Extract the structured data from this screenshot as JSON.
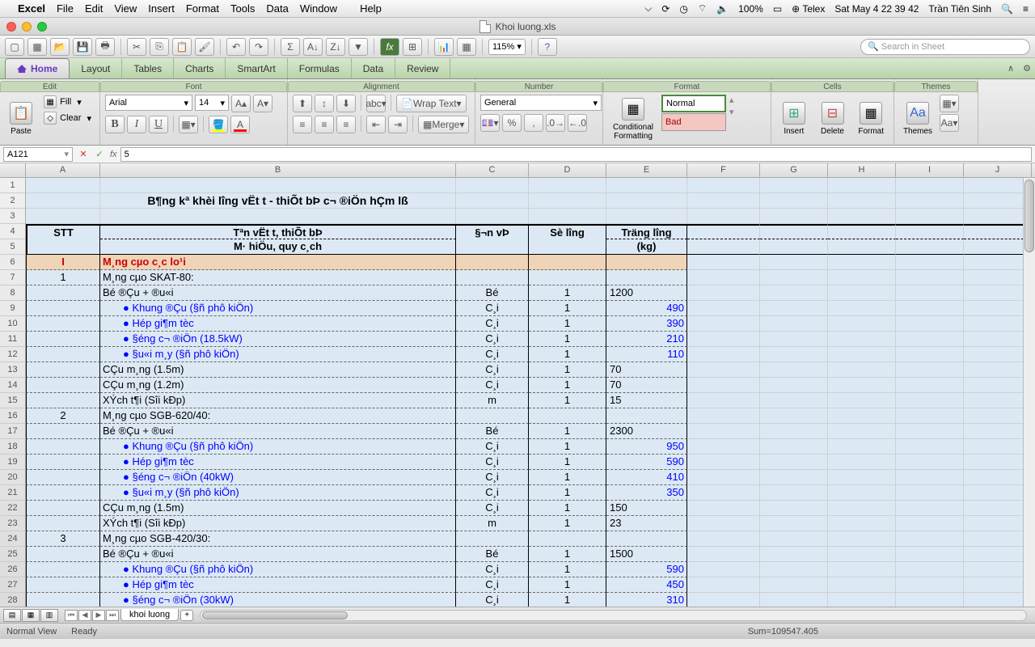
{
  "menubar": {
    "apple": "",
    "items": [
      "Excel",
      "File",
      "Edit",
      "View",
      "Insert",
      "Format",
      "Tools",
      "Data",
      "Window",
      "",
      "Help"
    ],
    "right": {
      "battery": "100%",
      "input": "⊕ Telex",
      "date": "Sat May 4  22 39 42",
      "user": "Trần Tiên Sinh"
    }
  },
  "window": {
    "title": "Khoi luong.xls"
  },
  "toolbar": {
    "zoom": "115%",
    "search_placeholder": "Search in Sheet"
  },
  "tabs": [
    "Home",
    "Layout",
    "Tables",
    "Charts",
    "SmartArt",
    "Formulas",
    "Data",
    "Review"
  ],
  "ribbon": {
    "groups": [
      "Edit",
      "Font",
      "Alignment",
      "Number",
      "Format",
      "Cells",
      "Themes"
    ],
    "edit": {
      "paste": "Paste",
      "fill": "Fill",
      "clear": "Clear"
    },
    "font": {
      "name": "Arial",
      "size": "14"
    },
    "align": {
      "wrap": "Wrap Text",
      "merge": "Merge"
    },
    "number": {
      "format": "General"
    },
    "format": {
      "cf": "Conditional\nFormatting",
      "styles": [
        "Normal",
        "Bad"
      ]
    },
    "cells": {
      "insert": "Insert",
      "delete": "Delete",
      "format": "Format"
    },
    "themes": {
      "themes": "Themes",
      "aa": "Aa"
    }
  },
  "formula": {
    "namebox": "A121",
    "fx": "fx",
    "value": "5"
  },
  "columns": [
    "A",
    "B",
    "C",
    "D",
    "E",
    "F",
    "G",
    "H",
    "I",
    "J"
  ],
  "rows_start": 1,
  "rows_end": 28,
  "sheet": {
    "title": "B¶ng kª khèi l­îng vËt t­ - thiÕt bÞ c¬ ®iÖn hÇm lß",
    "head1": {
      "A": "STT",
      "B": "Tªn vËt t­, thiÕt bÞ",
      "C": "§¬n vÞ",
      "D": "Sè l­îng",
      "E": "Träng l­îng"
    },
    "head2": {
      "B": "M· hiÖu, quy c¸ch",
      "E": "(kg)"
    },
    "section": {
      "A": "I",
      "B": "M¸ng cµo c¸c lo¹i"
    },
    "rows": [
      {
        "A": "1",
        "B": "M¸ng cµo SKAT-80:"
      },
      {
        "B": "Bé ®Çu + ®u«i",
        "C": "Bé",
        "D": "1",
        "E": "1200"
      },
      {
        "Bsub": "Khung ®Çu (§ñ phô kiÖn)",
        "C": "C¸i",
        "D": "1",
        "Ert": "490"
      },
      {
        "Bsub": "Hép gi¶m tèc",
        "C": "C¸i",
        "D": "1",
        "Ert": "390"
      },
      {
        "Bsub": "§éng c¬ ®iÖn (18.5kW)",
        "C": "C¸i",
        "D": "1",
        "Ert": "210"
      },
      {
        "Bsub": "§u«i m¸y (§ñ phô kiÖn)",
        "C": "C¸i",
        "D": "1",
        "Ert": "110"
      },
      {
        "B": "CÇu m¸ng (1.5m)",
        "C": "C¸i",
        "D": "1",
        "E": "70"
      },
      {
        "B": "CÇu m¸ng (1.2m)",
        "C": "C¸i",
        "D": "1",
        "E": "70"
      },
      {
        "B": "XÝch t¶i (Sîi kÐp)",
        "C": "m",
        "D": "1",
        "E": "15"
      },
      {
        "A": "2",
        "B": "M¸ng cµo SGB-620/40:"
      },
      {
        "B": "Bé ®Çu + ®u«i",
        "C": "Bé",
        "D": "1",
        "E": "2300"
      },
      {
        "Bsub": "Khung ®Çu (§ñ phô kiÖn)",
        "C": "C¸i",
        "D": "1",
        "Ert": "950"
      },
      {
        "Bsub": "Hép gi¶m tèc",
        "C": "C¸i",
        "D": "1",
        "Ert": "590"
      },
      {
        "Bsub": "§éng c¬ ®iÖn (40kW)",
        "C": "C¸i",
        "D": "1",
        "Ert": "410"
      },
      {
        "Bsub": "§u«i m¸y (§ñ phô kiÖn)",
        "C": "C¸i",
        "D": "1",
        "Ert": "350"
      },
      {
        "B": "CÇu m¸ng (1.5m)",
        "C": "C¸i",
        "D": "1",
        "E": "150"
      },
      {
        "B": "XÝch t¶i (Sîi kÐp)",
        "C": "m",
        "D": "1",
        "E": "23"
      },
      {
        "A": "3",
        "B": "M¸ng cµo SGB-420/30:"
      },
      {
        "B": "Bé ®Çu + ®u«i",
        "C": "Bé",
        "D": "1",
        "E": "1500"
      },
      {
        "Bsub": "Khung ®Çu (§ñ phô kiÖn)",
        "C": "C¸i",
        "D": "1",
        "Ert": "590"
      },
      {
        "Bsub": "Hép gi¶m tèc",
        "C": "C¸i",
        "D": "1",
        "Ert": "450"
      },
      {
        "Bsub": "§éng c¬ ®iÖn (30kW)",
        "C": "C¸i",
        "D": "1",
        "Ert": "310"
      }
    ]
  },
  "sheettab": "khoi luong",
  "status": {
    "view": "Normal View",
    "ready": "Ready",
    "sum": "Sum=109547.405"
  }
}
